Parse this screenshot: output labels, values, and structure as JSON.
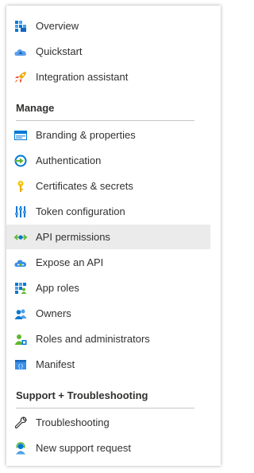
{
  "nav": {
    "items_top": [
      {
        "label": "Overview",
        "icon": "overview-grid-icon"
      },
      {
        "label": "Quickstart",
        "icon": "quickstart-cloud-icon"
      },
      {
        "label": "Integration assistant",
        "icon": "rocket-icon"
      }
    ],
    "manage_header": "Manage",
    "manage_items": [
      {
        "label": "Branding & properties",
        "icon": "branding-icon"
      },
      {
        "label": "Authentication",
        "icon": "authentication-icon"
      },
      {
        "label": "Certificates & secrets",
        "icon": "key-icon"
      },
      {
        "label": "Token configuration",
        "icon": "token-config-icon"
      },
      {
        "label": "API permissions",
        "icon": "api-permissions-icon",
        "active": true
      },
      {
        "label": "Expose an API",
        "icon": "expose-api-cloud-icon"
      },
      {
        "label": "App roles",
        "icon": "app-roles-grid-icon"
      },
      {
        "label": "Owners",
        "icon": "owners-people-icon"
      },
      {
        "label": "Roles and administrators",
        "icon": "roles-admin-icon"
      },
      {
        "label": "Manifest",
        "icon": "manifest-icon"
      }
    ],
    "support_header": "Support + Troubleshooting",
    "support_items": [
      {
        "label": "Troubleshooting",
        "icon": "wrench-icon"
      },
      {
        "label": "New support request",
        "icon": "support-person-icon"
      }
    ]
  },
  "colors": {
    "active_bg": "#ebebeb",
    "text": "#323130",
    "blue": "#0078d4"
  }
}
